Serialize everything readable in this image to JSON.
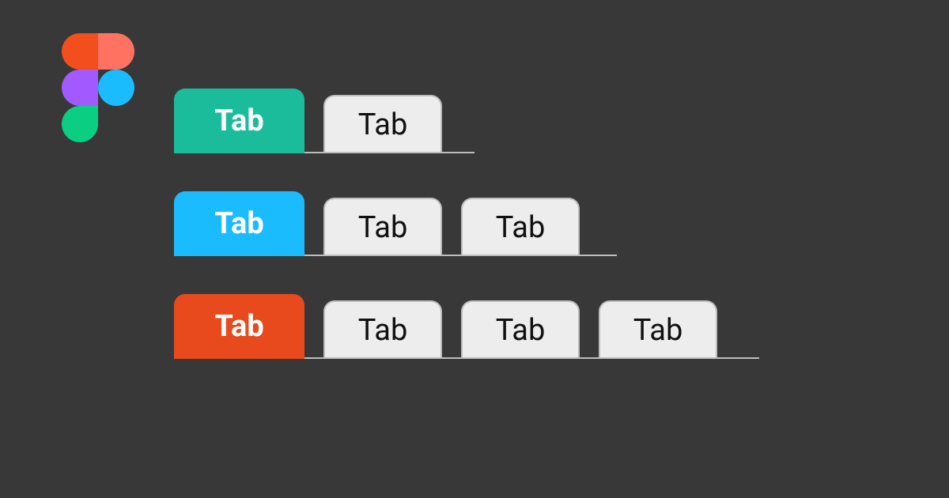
{
  "logo": "figma",
  "colors": {
    "bg": "#383838",
    "inactive_fill": "#EDEDED",
    "inactive_border": "#BDBDBD",
    "row1_active": "#1ABC9C",
    "row2_active": "#1ABCFE",
    "row3_active": "#E8491D"
  },
  "rows": [
    {
      "active_color": "#1ABC9C",
      "underline_right": 360,
      "tabs": [
        {
          "label": "Tab",
          "active": true
        },
        {
          "label": "Tab",
          "active": false
        }
      ]
    },
    {
      "active_color": "#1ABCFE",
      "underline_right": 540,
      "tabs": [
        {
          "label": "Tab",
          "active": true
        },
        {
          "label": "Tab",
          "active": false
        },
        {
          "label": "Tab",
          "active": false
        }
      ]
    },
    {
      "active_color": "#E8491D",
      "underline_right": 720,
      "tabs": [
        {
          "label": "Tab",
          "active": true
        },
        {
          "label": "Tab",
          "active": false
        },
        {
          "label": "Tab",
          "active": false
        },
        {
          "label": "Tab",
          "active": false
        }
      ]
    }
  ]
}
